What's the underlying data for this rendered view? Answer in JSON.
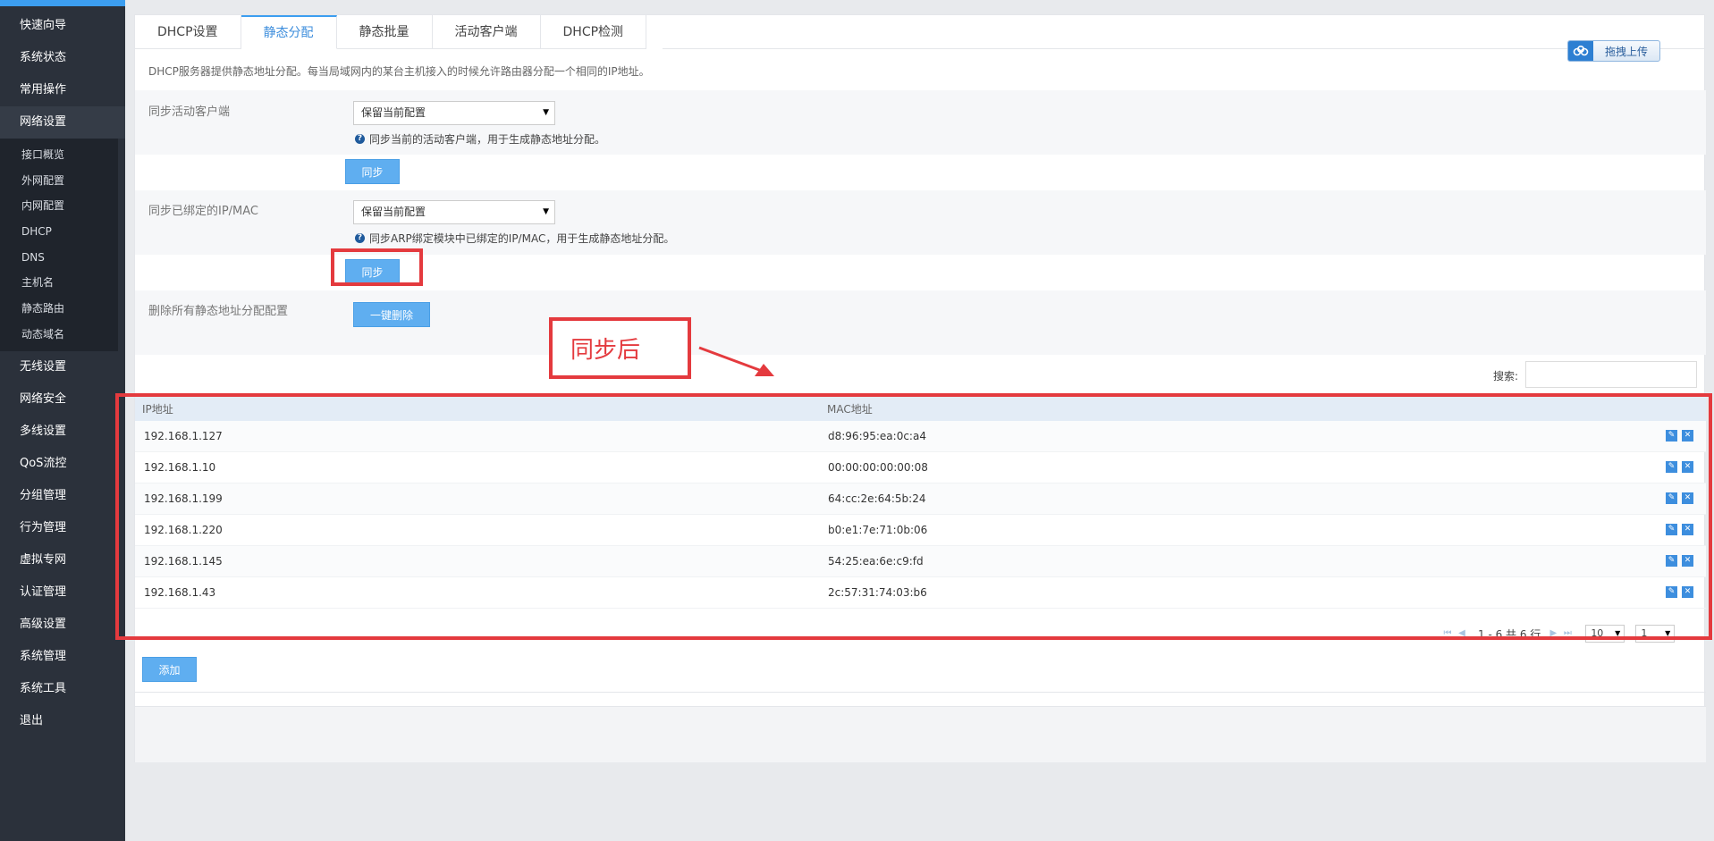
{
  "sidebar": {
    "items": [
      {
        "label": "快速向导"
      },
      {
        "label": "系统状态"
      },
      {
        "label": "常用操作"
      },
      {
        "label": "网络设置",
        "active": true
      },
      {
        "label": "无线设置"
      },
      {
        "label": "网络安全"
      },
      {
        "label": "多线设置"
      },
      {
        "label": "QoS流控"
      },
      {
        "label": "分组管理"
      },
      {
        "label": "行为管理"
      },
      {
        "label": "虚拟专网"
      },
      {
        "label": "认证管理"
      },
      {
        "label": "高级设置"
      },
      {
        "label": "系统管理"
      },
      {
        "label": "系统工具"
      },
      {
        "label": "退出"
      }
    ],
    "subitems": [
      {
        "label": "接口概览"
      },
      {
        "label": "外网配置"
      },
      {
        "label": "内网配置"
      },
      {
        "label": "DHCP"
      },
      {
        "label": "DNS"
      },
      {
        "label": "主机名"
      },
      {
        "label": "静态路由"
      },
      {
        "label": "动态域名"
      }
    ]
  },
  "tabs": [
    {
      "label": "DHCP设置"
    },
    {
      "label": "静态分配",
      "active": true
    },
    {
      "label": "静态批量"
    },
    {
      "label": "活动客户端"
    },
    {
      "label": "DHCP检测"
    }
  ],
  "upload_button": "拖拽上传",
  "intro_text": "DHCP服务器提供静态地址分配。每当局域网内的某台主机接入的时候允许路由器分配一个相同的IP地址。",
  "sync_clients": {
    "label": "同步活动客户端",
    "select_value": "保留当前配置",
    "hint": "同步当前的活动客户端，用于生成静态地址分配。",
    "button": "同步"
  },
  "sync_ipmac": {
    "label": "同步已绑定的IP/MAC",
    "select_value": "保留当前配置",
    "hint": "同步ARP绑定模块中已绑定的IP/MAC，用于生成静态地址分配。",
    "button": "同步"
  },
  "delete_all": {
    "label": "删除所有静态地址分配配置",
    "button": "一键删除"
  },
  "annotation": {
    "text": "同步后",
    "color": "#e43a3e"
  },
  "search": {
    "label": "搜索:",
    "value": ""
  },
  "table": {
    "columns": [
      "IP地址",
      "MAC地址"
    ],
    "rows": [
      {
        "ip": "192.168.1.127",
        "mac": "d8:96:95:ea:0c:a4"
      },
      {
        "ip": "192.168.1.10",
        "mac": "00:00:00:00:00:08"
      },
      {
        "ip": "192.168.1.199",
        "mac": "64:cc:2e:64:5b:24"
      },
      {
        "ip": "192.168.1.220",
        "mac": "b0:e1:7e:71:0b:06"
      },
      {
        "ip": "192.168.1.145",
        "mac": "54:25:ea:6e:c9:fd"
      },
      {
        "ip": "192.168.1.43",
        "mac": "2c:57:31:74:03:b6"
      }
    ]
  },
  "pager": {
    "summary": "1 - 6 共 6 行",
    "page_size": "10",
    "page": "1"
  },
  "add_button": "添加",
  "colors": {
    "accent": "#3c9ef0",
    "sidebar_bg": "#2b313b",
    "button": "#5faef0"
  }
}
